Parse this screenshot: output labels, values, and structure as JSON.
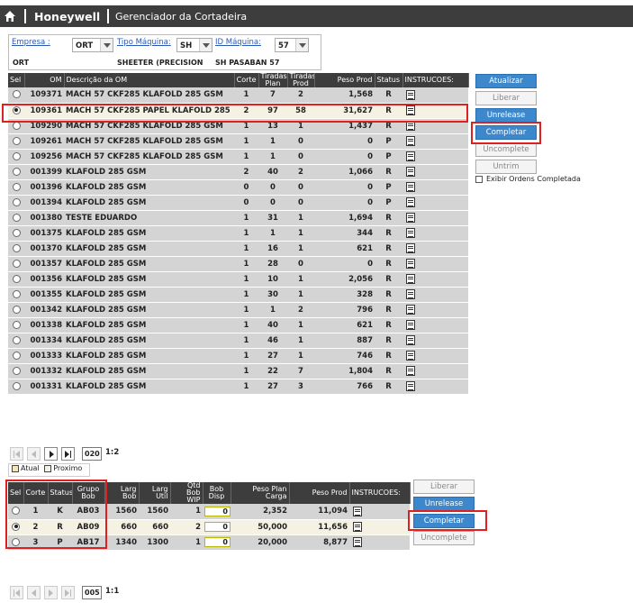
{
  "header": {
    "brand": "Honeywell",
    "title": "Gerenciador da Cortadeira"
  },
  "filters": {
    "empresa": {
      "label": "Empresa :",
      "value": "ORT",
      "display": "ORT"
    },
    "tipo": {
      "label": "Tipo Máquina:",
      "value": "SH",
      "display": "SHEETER (PRECISION"
    },
    "id": {
      "label": "ID Máquina:",
      "value": "57",
      "display": "SH PASABAN 57"
    }
  },
  "orders_table": {
    "columns": [
      "Sel",
      "OM",
      "Descrição da OM",
      "Corte",
      "Tiradas Plan",
      "Tiradas Prod",
      "Peso Prod",
      "Status",
      "INSTRUCOES:"
    ],
    "rows": [
      {
        "om": "109371",
        "desc": "MACH 57 CKF285 KLAFOLD 285 GSM",
        "corte": "1",
        "plan": "7",
        "prod": "2",
        "peso": "1,568",
        "status": "R",
        "selected": false
      },
      {
        "om": "109361",
        "desc": "MACH 57 CKF285 PAPEL KLAFOLD 285",
        "corte": "2",
        "plan": "97",
        "prod": "58",
        "peso": "31,627",
        "status": "R",
        "selected": true
      },
      {
        "om": "109290",
        "desc": "MACH 57 CKF285 KLAFOLD 285 GSM",
        "corte": "1",
        "plan": "13",
        "prod": "1",
        "peso": "1,437",
        "status": "R",
        "selected": false
      },
      {
        "om": "109261",
        "desc": "MACH 57 CKF285 KLAFOLD 285 GSM",
        "corte": "1",
        "plan": "1",
        "prod": "0",
        "peso": "0",
        "status": "P",
        "selected": false
      },
      {
        "om": "109256",
        "desc": "MACH 57 CKF285 KLAFOLD 285 GSM",
        "corte": "1",
        "plan": "1",
        "prod": "0",
        "peso": "0",
        "status": "P",
        "selected": false
      },
      {
        "om": "001399",
        "desc": "KLAFOLD 285 GSM",
        "corte": "2",
        "plan": "40",
        "prod": "2",
        "peso": "1,066",
        "status": "R",
        "selected": false
      },
      {
        "om": "001396",
        "desc": "KLAFOLD 285 GSM",
        "corte": "0",
        "plan": "0",
        "prod": "0",
        "peso": "0",
        "status": "P",
        "selected": false
      },
      {
        "om": "001394",
        "desc": "KLAFOLD 285 GSM",
        "corte": "0",
        "plan": "0",
        "prod": "0",
        "peso": "0",
        "status": "P",
        "selected": false
      },
      {
        "om": "001380",
        "desc": "TESTE EDUARDO",
        "corte": "1",
        "plan": "31",
        "prod": "1",
        "peso": "1,694",
        "status": "R",
        "selected": false
      },
      {
        "om": "001375",
        "desc": "KLAFOLD 285 GSM",
        "corte": "1",
        "plan": "1",
        "prod": "1",
        "peso": "344",
        "status": "R",
        "selected": false
      },
      {
        "om": "001370",
        "desc": "KLAFOLD 285 GSM",
        "corte": "1",
        "plan": "16",
        "prod": "1",
        "peso": "621",
        "status": "R",
        "selected": false
      },
      {
        "om": "001357",
        "desc": "KLAFOLD 285 GSM",
        "corte": "1",
        "plan": "28",
        "prod": "0",
        "peso": "0",
        "status": "R",
        "selected": false
      },
      {
        "om": "001356",
        "desc": "KLAFOLD 285 GSM",
        "corte": "1",
        "plan": "10",
        "prod": "1",
        "peso": "2,056",
        "status": "R",
        "selected": false
      },
      {
        "om": "001355",
        "desc": "KLAFOLD 285 GSM",
        "corte": "1",
        "plan": "30",
        "prod": "1",
        "peso": "328",
        "status": "R",
        "selected": false
      },
      {
        "om": "001342",
        "desc": "KLAFOLD 285 GSM",
        "corte": "1",
        "plan": "1",
        "prod": "2",
        "peso": "796",
        "status": "R",
        "selected": false
      },
      {
        "om": "001338",
        "desc": "KLAFOLD 285 GSM",
        "corte": "1",
        "plan": "40",
        "prod": "1",
        "peso": "621",
        "status": "R",
        "selected": false
      },
      {
        "om": "001334",
        "desc": "KLAFOLD 285 GSM",
        "corte": "1",
        "plan": "46",
        "prod": "1",
        "peso": "887",
        "status": "R",
        "selected": false
      },
      {
        "om": "001333",
        "desc": "KLAFOLD 285 GSM",
        "corte": "1",
        "plan": "27",
        "prod": "1",
        "peso": "746",
        "status": "R",
        "selected": false
      },
      {
        "om": "001332",
        "desc": "KLAFOLD 285 GSM",
        "corte": "1",
        "plan": "22",
        "prod": "7",
        "peso": "1,804",
        "status": "R",
        "selected": false
      },
      {
        "om": "001331",
        "desc": "KLAFOLD 285 GSM",
        "corte": "1",
        "plan": "27",
        "prod": "3",
        "peso": "766",
        "status": "R",
        "selected": false
      }
    ]
  },
  "order_actions": {
    "atualizar": "Atualizar",
    "liberar": "Liberar",
    "unrelease": "Unrelease",
    "completar": "Completar",
    "uncomplete": "Uncomplete",
    "untrim": "Untrim",
    "exibir": "Exibir Ordens Completada"
  },
  "pager1": {
    "value": "020",
    "label": "1:2"
  },
  "legend": {
    "atual": "Atual",
    "proximo": "Proximo",
    "atual_color": "#f5e6b8",
    "proximo_color": "#f5f1e3"
  },
  "cuts_table": {
    "columns": [
      "Sel",
      "Corte",
      "Status",
      "Grupo Bob",
      "Larg Bob",
      "Larg Util",
      "Qtd Bob WIP",
      "Bob Disp",
      "Peso Plan Carga",
      "Peso Prod",
      "INSTRUCOES:"
    ],
    "rows": [
      {
        "corte": "1",
        "status": "K",
        "grupo": "AB03",
        "larg_bob": "1560",
        "larg_util": "1560",
        "wip": "1",
        "disp": "0",
        "plan": "2,352",
        "prod": "11,094",
        "selected": false
      },
      {
        "corte": "2",
        "status": "R",
        "grupo": "AB09",
        "larg_bob": "660",
        "larg_util": "660",
        "wip": "2",
        "disp": "0",
        "plan": "50,000",
        "prod": "11,656",
        "selected": true
      },
      {
        "corte": "3",
        "status": "P",
        "grupo": "AB17",
        "larg_bob": "1340",
        "larg_util": "1300",
        "wip": "1",
        "disp": "0",
        "plan": "20,000",
        "prod": "8,877",
        "selected": false
      }
    ]
  },
  "cut_actions": {
    "liberar": "Liberar",
    "unrelease": "Unrelease",
    "completar": "Completar",
    "uncomplete": "Uncomplete"
  },
  "pager2": {
    "value": "005",
    "label": "1:1"
  }
}
